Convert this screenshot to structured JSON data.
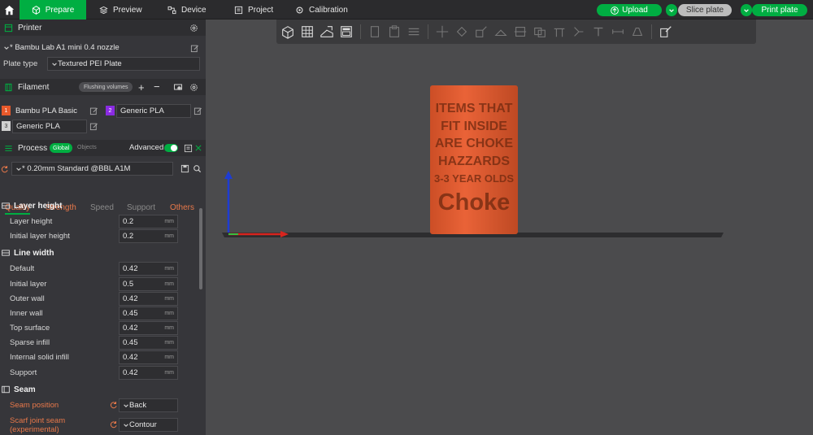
{
  "topbar": {
    "tabs": [
      {
        "label": "Prepare"
      },
      {
        "label": "Preview"
      },
      {
        "label": "Device"
      },
      {
        "label": "Project"
      },
      {
        "label": "Calibration"
      }
    ],
    "upload_label": "Upload",
    "slice_label": "Slice plate",
    "print_label": "Print plate"
  },
  "printer": {
    "title": "Printer",
    "name": "* Bambu Lab A1 mini 0.4 nozzle",
    "plate_type_label": "Plate type",
    "plate_type_value": "Textured PEI Plate"
  },
  "filament": {
    "title": "Filament",
    "flushing_label": "Flushing volumes",
    "items": [
      {
        "num": "1",
        "name": "Bambu PLA Basic",
        "color": "#e8592b"
      },
      {
        "num": "2",
        "name": "Generic PLA",
        "color": "#8a2be2"
      },
      {
        "num": "3",
        "name": "Generic PLA",
        "color": "#d0d0d0"
      }
    ]
  },
  "process": {
    "title": "Process",
    "global_label": "Global",
    "objects_label": "Objects",
    "advanced_label": "Advanced",
    "preset": "* 0.20mm Standard @BBL A1M",
    "subtabs": [
      "Quality",
      "Strength",
      "Speed",
      "Support",
      "Others"
    ]
  },
  "settings": {
    "layer_height": {
      "title": "Layer height",
      "rows": [
        {
          "label": "Layer height",
          "value": "0.2",
          "unit": "mm"
        },
        {
          "label": "Initial layer height",
          "value": "0.2",
          "unit": "mm"
        }
      ]
    },
    "line_width": {
      "title": "Line width",
      "rows": [
        {
          "label": "Default",
          "value": "0.42",
          "unit": "mm"
        },
        {
          "label": "Initial layer",
          "value": "0.5",
          "unit": "mm"
        },
        {
          "label": "Outer wall",
          "value": "0.42",
          "unit": "mm"
        },
        {
          "label": "Inner wall",
          "value": "0.45",
          "unit": "mm"
        },
        {
          "label": "Top surface",
          "value": "0.42",
          "unit": "mm"
        },
        {
          "label": "Sparse infill",
          "value": "0.45",
          "unit": "mm"
        },
        {
          "label": "Internal solid infill",
          "value": "0.42",
          "unit": "mm"
        },
        {
          "label": "Support",
          "value": "0.42",
          "unit": "mm"
        }
      ]
    },
    "seam": {
      "title": "Seam",
      "seam_position_label": "Seam position",
      "seam_position_value": "Back",
      "scarf_label_1": "Scarf joint seam",
      "scarf_label_2": "(experimental)",
      "scarf_value": "Contour"
    }
  },
  "model": {
    "lines": [
      "ITEMS THAT",
      "FIT INSIDE",
      "ARE CHOKE",
      "HAZZARDS",
      "3-3 YEAR OLDS",
      "Choke"
    ],
    "color": "#e8592b"
  },
  "colors": {
    "accent_green": "#00ae42",
    "accent_orange": "#e8784a"
  }
}
